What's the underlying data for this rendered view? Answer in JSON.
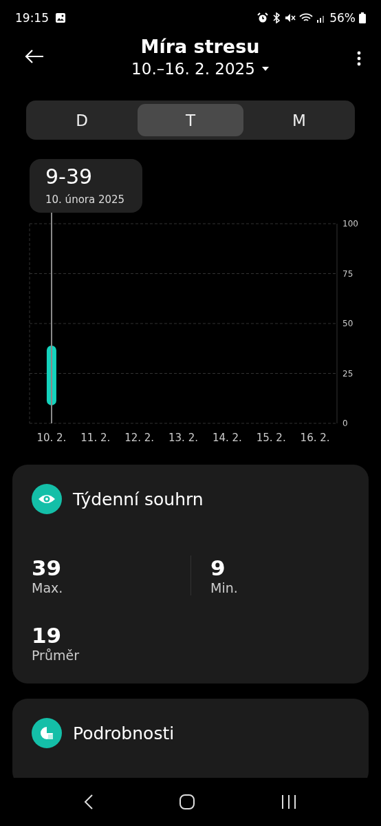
{
  "status_bar": {
    "time": "19:15",
    "battery": "56%"
  },
  "header": {
    "title": "Míra stresu",
    "date_range": "10.–16. 2. 2025"
  },
  "tabs": [
    {
      "label": "D",
      "selected": false
    },
    {
      "label": "T",
      "selected": true
    },
    {
      "label": "M",
      "selected": false
    }
  ],
  "tooltip": {
    "value": "9-39",
    "date": "10. února 2025"
  },
  "chart": {
    "chart_data": {
      "type": "candlestick",
      "categories": [
        "10. 2.",
        "11. 2.",
        "12. 2.",
        "13. 2.",
        "14. 2.",
        "15. 2.",
        "16. 2."
      ],
      "series": [
        {
          "color": "#14d3bd",
          "ohlc": [
            [
              9,
              39,
              9,
              39
            ],
            null,
            null,
            null,
            null,
            null,
            null
          ]
        }
      ],
      "ylim": [
        0,
        100
      ],
      "yticks": [
        0,
        25,
        50,
        75,
        100
      ],
      "grid": true
    }
  },
  "summary": {
    "title": "Týdenní souhrn",
    "stats": [
      {
        "value": "39",
        "label": "Max."
      },
      {
        "value": "9",
        "label": "Min."
      },
      {
        "value": "19",
        "label": "Průměr"
      }
    ]
  },
  "details": {
    "title": "Podrobnosti"
  }
}
